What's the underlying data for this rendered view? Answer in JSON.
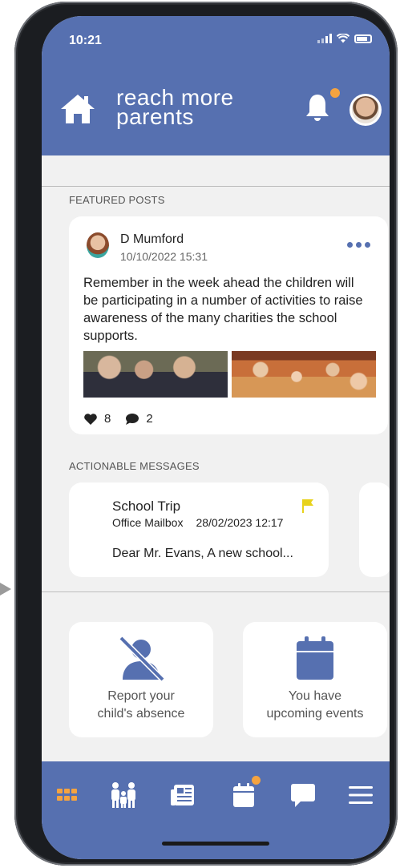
{
  "status": {
    "time": "10:21"
  },
  "header": {
    "logo_line1": "reach more",
    "logo_line2": "parents"
  },
  "featured": {
    "label": "FEATURED POSTS",
    "post": {
      "author": "D Mumford",
      "date": "10/10/2022 15:31",
      "text": "Remember in the week ahead the children will be participating in a number of activities to raise awareness of the many charities the school supports.",
      "likes": "8",
      "comments": "2"
    }
  },
  "actionable": {
    "label": "ACTIONABLE MESSAGES",
    "message": {
      "title": "School Trip",
      "sender": "Office Mailbox",
      "date": "28/02/2023 12:17",
      "preview": "Dear Mr. Evans, A new school..."
    }
  },
  "tiles": {
    "absence": {
      "line1": "Report your",
      "line2": "child's absence"
    },
    "events": {
      "line1": "You have",
      "line2": "upcoming events"
    }
  },
  "colors": {
    "brand": "#5670b0",
    "accent": "#f4a340",
    "flag": "#e8d21c"
  },
  "nav": {
    "icons": [
      "apps-grid-icon",
      "family-icon",
      "newspaper-icon",
      "calendar-icon",
      "chat-icon",
      "menu-icon"
    ]
  }
}
